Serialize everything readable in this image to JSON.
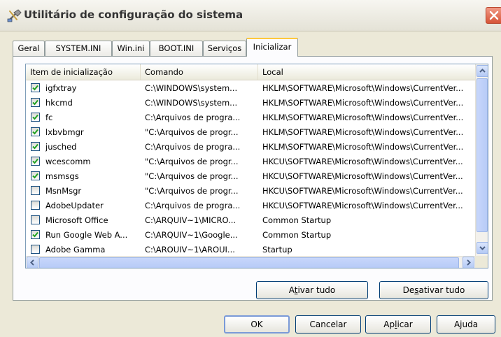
{
  "window": {
    "title": "Utilitário de configuração do sistema",
    "accent": "#ffc83c",
    "close_color": "#d65437"
  },
  "tabs": [
    {
      "label": "Geral"
    },
    {
      "label": "SYSTEM.INI"
    },
    {
      "label": "Win.ini"
    },
    {
      "label": "BOOT.INI"
    },
    {
      "label": "Serviços"
    },
    {
      "label": "Inicializar",
      "active": true
    }
  ],
  "list": {
    "columns": [
      "Item de inicialização",
      "Comando",
      "Local"
    ],
    "rows": [
      {
        "checked": true,
        "name": "igfxtray",
        "command": "C:\\WINDOWS\\system...",
        "location": "HKLM\\SOFTWARE\\Microsoft\\Windows\\CurrentVer..."
      },
      {
        "checked": true,
        "name": "hkcmd",
        "command": "C:\\WINDOWS\\system...",
        "location": "HKLM\\SOFTWARE\\Microsoft\\Windows\\CurrentVer..."
      },
      {
        "checked": true,
        "name": "fc",
        "command": "C:\\Arquivos de progra...",
        "location": "HKLM\\SOFTWARE\\Microsoft\\Windows\\CurrentVer..."
      },
      {
        "checked": true,
        "name": "lxbvbmgr",
        "command": "\"C:\\Arquivos de progr...",
        "location": "HKLM\\SOFTWARE\\Microsoft\\Windows\\CurrentVer..."
      },
      {
        "checked": true,
        "name": "jusched",
        "command": "C:\\Arquivos de progra...",
        "location": "HKLM\\SOFTWARE\\Microsoft\\Windows\\CurrentVer..."
      },
      {
        "checked": true,
        "name": "wcescomm",
        "command": "\"C:\\Arquivos de progr...",
        "location": "HKCU\\SOFTWARE\\Microsoft\\Windows\\CurrentVer..."
      },
      {
        "checked": true,
        "name": "msmsgs",
        "command": "\"C:\\Arquivos de progr...",
        "location": "HKCU\\SOFTWARE\\Microsoft\\Windows\\CurrentVer..."
      },
      {
        "checked": false,
        "name": "MsnMsgr",
        "command": "\"C:\\Arquivos de progr...",
        "location": "HKCU\\SOFTWARE\\Microsoft\\Windows\\CurrentVer..."
      },
      {
        "checked": false,
        "name": "AdobeUpdater",
        "command": "C:\\Arquivos de progra...",
        "location": "HKCU\\SOFTWARE\\Microsoft\\Windows\\CurrentVer..."
      },
      {
        "checked": false,
        "name": "Microsoft Office",
        "command": "C:\\ARQUIV~1\\MICRO...",
        "location": "Common Startup"
      },
      {
        "checked": true,
        "name": "Run Google Web A...",
        "command": "C:\\ARQUIV~1\\Google...",
        "location": "Common Startup"
      },
      {
        "checked": false,
        "name": "Adobe Gamma",
        "command": "C:\\AROUIV~1\\AROUI...",
        "location": "Startup"
      }
    ]
  },
  "buttons": {
    "enable_all": "Ativar tudo",
    "disable_all": "Desativar tudo",
    "ok": "OK",
    "cancel": "Cancelar",
    "apply": "Aplicar",
    "help": "Ajuda"
  }
}
